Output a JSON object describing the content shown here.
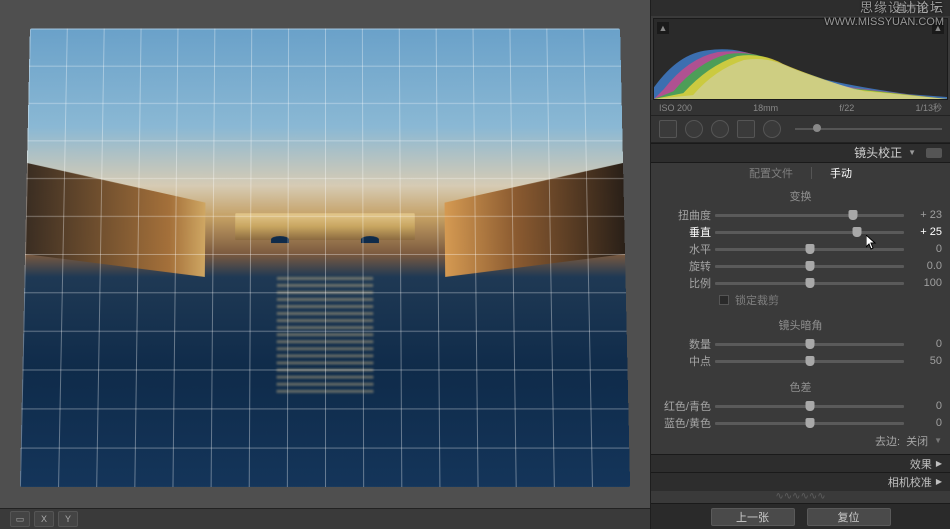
{
  "watermark": {
    "line1": "思缘设计论坛",
    "line2": "WWW.MISSYUAN.COM"
  },
  "histogram": {
    "title": "直方图",
    "iso": "ISO 200",
    "focal": "18mm",
    "aperture": "f/22",
    "shutter": "1/13秒"
  },
  "section": {
    "lens": "镜头校正",
    "effects": "效果",
    "calibration": "相机校准"
  },
  "tabs": {
    "profile": "配置文件",
    "manual": "手动"
  },
  "transform": {
    "title": "变换",
    "distortion": {
      "label": "扭曲度",
      "value": "+ 23",
      "pos": 73
    },
    "vertical": {
      "label": "垂直",
      "value": "+ 25",
      "pos": 75
    },
    "horizontal": {
      "label": "水平",
      "value": "0",
      "pos": 50
    },
    "rotate": {
      "label": "旋转",
      "value": "0.0",
      "pos": 50
    },
    "scale": {
      "label": "比例",
      "value": "100",
      "pos": 50
    },
    "constrain": "锁定裁剪"
  },
  "vignette": {
    "title": "镜头暗角",
    "amount": {
      "label": "数量",
      "value": "0",
      "pos": 50
    },
    "midpoint": {
      "label": "中点",
      "value": "50",
      "pos": 50
    }
  },
  "ca": {
    "title": "色差",
    "rc": {
      "label": "红色/青色",
      "value": "0",
      "pos": 50
    },
    "by": {
      "label": "蓝色/黄色",
      "value": "0",
      "pos": 50
    },
    "defringe_label": "去边:",
    "defringe_value": "关闭"
  },
  "nav": {
    "prev": "上一张",
    "reset": "复位"
  },
  "toolbar": {
    "x": "X",
    "y": "Y"
  }
}
